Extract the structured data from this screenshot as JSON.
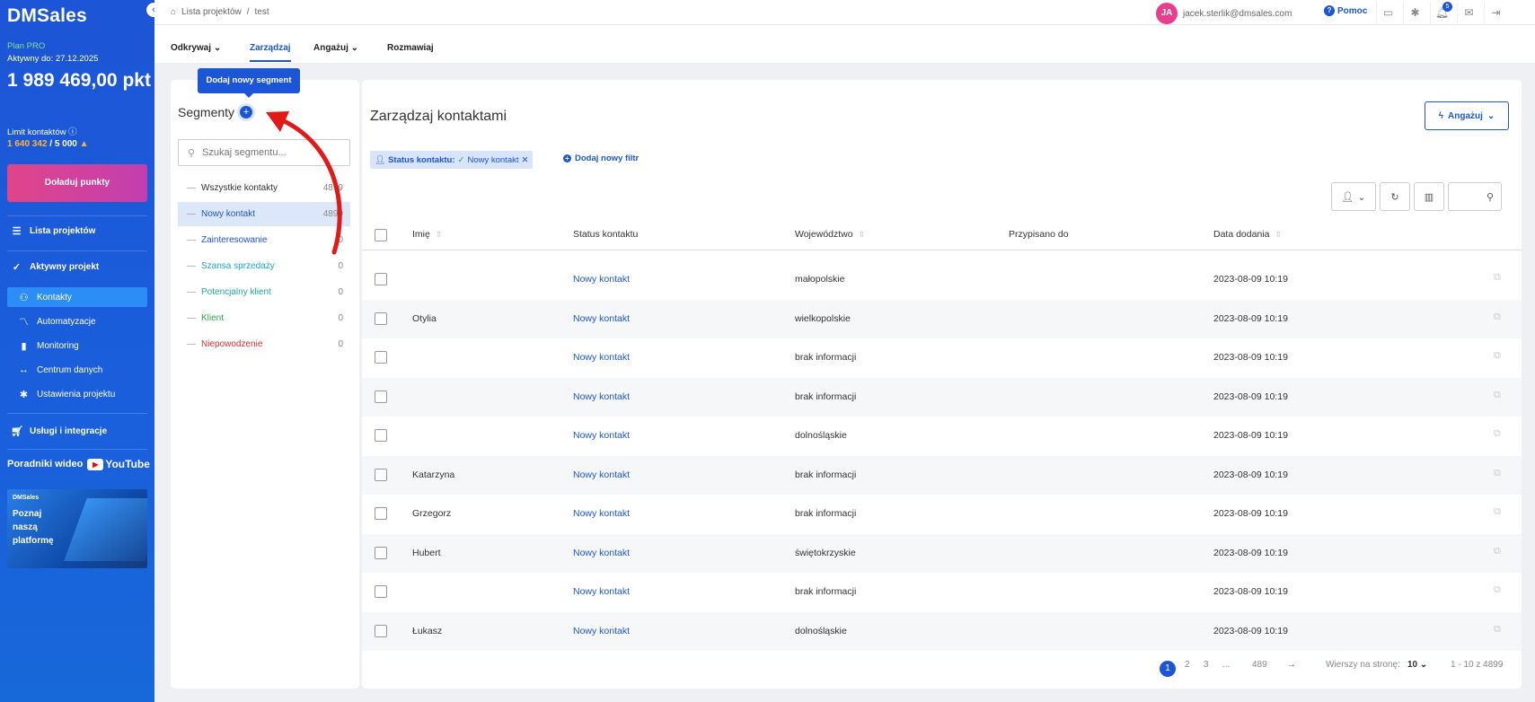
{
  "sidebar": {
    "logo": "DMSales",
    "collapse_icon": "‹",
    "plan": "Plan PRO",
    "active_until": "Aktywny do: 27.12.2025",
    "points": "1 989 469,00 pkt",
    "limit_label": "Limit kontaktów",
    "limit_current": "1 640 342",
    "limit_max": "/ 5 000",
    "topup_button": "Doładuj punkty",
    "nav": {
      "projects": "Lista projektów",
      "active_project": "Aktywny projekt",
      "contacts": "Kontakty",
      "automations": "Automatyzacje",
      "monitoring": "Monitoring",
      "data_center": "Centrum danych",
      "project_settings": "Ustawienia projektu",
      "services": "Usługi i integracje"
    },
    "video_guides": "Poradniki wideo",
    "youtube": "YouTube",
    "promo": {
      "brand": "DMSales",
      "text": "Poznaj naszą platformę"
    }
  },
  "topbar": {
    "breadcrumb_root": "Lista projektów",
    "breadcrumb_sep": "/",
    "breadcrumb_current": "test",
    "avatar_initials": "JA",
    "email": "jacek.sterlik@dmsales.com",
    "help": "Pomoc",
    "notifications_count": "5"
  },
  "tabs": {
    "discover": "Odkrywaj",
    "manage": "Zarządzaj",
    "engage": "Angażuj",
    "talk": "Rozmawiaj"
  },
  "tooltip": "Dodaj nowy segment",
  "segments": {
    "title": "Segmenty",
    "search_placeholder": "Szukaj segmentu...",
    "items": [
      {
        "label": "Wszystkie kontakty",
        "count": "4899",
        "color": "#333333"
      },
      {
        "label": "Nowy kontakt",
        "count": "4899",
        "color": "#1c55d6"
      },
      {
        "label": "Zainteresowanie",
        "count": "0",
        "color": "#1c55d6"
      },
      {
        "label": "Szansa sprzedaży",
        "count": "0",
        "color": "#19a7c9"
      },
      {
        "label": "Potencjalny klient",
        "count": "0",
        "color": "#1fa89a"
      },
      {
        "label": "Klient",
        "count": "0",
        "color": "#2ba84a"
      },
      {
        "label": "Niepowodzenie",
        "count": "0",
        "color": "#d9302c"
      }
    ]
  },
  "main": {
    "title": "Zarządzaj kontaktami",
    "engage_button": "Angażuj",
    "filter_label": "Status kontaktu:",
    "filter_value": "Nowy kontakt",
    "add_filter": "Dodaj nowy filtr",
    "columns": {
      "name": "Imię",
      "status": "Status kontaktu",
      "region": "Województwo",
      "assigned": "Przypisano do",
      "date": "Data dodania"
    },
    "rows": [
      {
        "name": "",
        "status": "Nowy kontakt",
        "region": "małopolskie",
        "assigned": "",
        "date": "2023-08-09 10:19"
      },
      {
        "name": "Otylia",
        "status": "Nowy kontakt",
        "region": "wielkopolskie",
        "assigned": "",
        "date": "2023-08-09 10:19"
      },
      {
        "name": "",
        "status": "Nowy kontakt",
        "region": "brak informacji",
        "assigned": "",
        "date": "2023-08-09 10:19"
      },
      {
        "name": "",
        "status": "Nowy kontakt",
        "region": "brak informacji",
        "assigned": "",
        "date": "2023-08-09 10:19"
      },
      {
        "name": "",
        "status": "Nowy kontakt",
        "region": "dolnośląskie",
        "assigned": "",
        "date": "2023-08-09 10:19"
      },
      {
        "name": "Katarzyna",
        "status": "Nowy kontakt",
        "region": "brak informacji",
        "assigned": "",
        "date": "2023-08-09 10:19"
      },
      {
        "name": "Grzegorz",
        "status": "Nowy kontakt",
        "region": "brak informacji",
        "assigned": "",
        "date": "2023-08-09 10:19"
      },
      {
        "name": "Hubert",
        "status": "Nowy kontakt",
        "region": "świętokrzyskie",
        "assigned": "",
        "date": "2023-08-09 10:19"
      },
      {
        "name": "",
        "status": "Nowy kontakt",
        "region": "brak informacji",
        "assigned": "",
        "date": "2023-08-09 10:19"
      },
      {
        "name": "Łukasz",
        "status": "Nowy kontakt",
        "region": "dolnośląskie",
        "assigned": "",
        "date": "2023-08-09 10:19"
      }
    ],
    "pagination": {
      "pages": [
        "1",
        "2",
        "3",
        "...",
        "489"
      ],
      "next": "→",
      "rows_per_page_label": "Wierszy na stronę:",
      "rows_per_page": "10",
      "range": "1 - 10 z 4899"
    }
  },
  "colors": {
    "accent": "#1c55d6",
    "annotation_arrow": "#e01919",
    "topup_gradient_start": "#e0458a",
    "topup_gradient_end": "#c23eb0"
  }
}
